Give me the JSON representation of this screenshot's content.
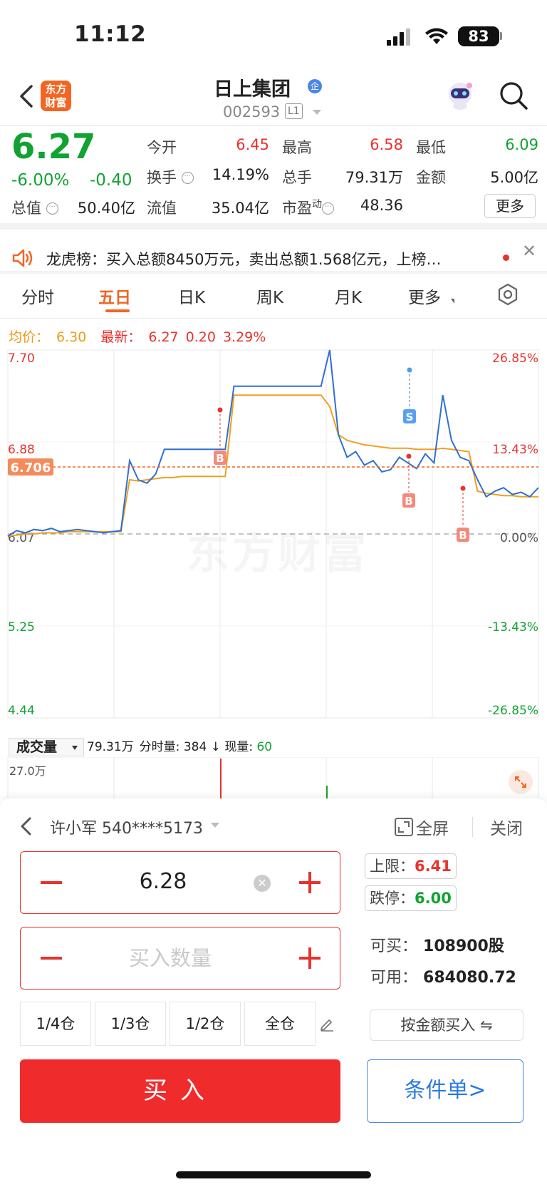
{
  "status": {
    "time": "11:12",
    "battery": "83"
  },
  "header": {
    "logo_line1": "东方",
    "logo_line2": "财富",
    "stock_name": "日上集团",
    "corp_badge": "企",
    "stock_code": "002593",
    "level_badge": "L1"
  },
  "quote": {
    "price": "6.27",
    "pct_change": "-6.00%",
    "change": "-0.40",
    "fields": {
      "open_label": "今开",
      "open_val": "6.45",
      "high_label": "最高",
      "high_val": "6.58",
      "low_label": "最低",
      "low_val": "6.09",
      "turnover_label": "换手",
      "turnover_val": "14.19%",
      "volume_label": "总手",
      "volume_val": "79.31万",
      "amount_label": "金额",
      "amount_val": "5.00亿",
      "mktcap_label": "总值",
      "mktcap_val": "50.40亿",
      "float_label": "流值",
      "float_val": "35.04亿",
      "pe_label": "市盈",
      "pe_sup": "动",
      "pe_val": "48.36"
    },
    "more_label": "更多"
  },
  "news": {
    "text": "龙虎榜：买入总额8450万元，卖出总额1.568亿元，上榜…"
  },
  "tabs": [
    "分时",
    "五日",
    "日K",
    "周K",
    "月K",
    "更多"
  ],
  "active_tab": "五日",
  "chart_info": {
    "avg_label": "均价：",
    "avg_val": "6.30",
    "latest_label": "最新：",
    "latest_val": "6.27",
    "latest_chg": "0.20",
    "latest_pct": "3.29%"
  },
  "chart_data": {
    "type": "line",
    "left_ticks": [
      "7.70",
      "6.88",
      "6.07",
      "5.25",
      "4.44"
    ],
    "right_ticks": [
      "26.85%",
      "13.43%",
      "0.00%",
      "-13.43%",
      "-26.85%"
    ],
    "ylim": [
      4.44,
      7.7
    ],
    "days": 5,
    "crosshair_label": "6.706",
    "markers": [
      "B",
      "B",
      "S",
      "B"
    ],
    "series": [
      {
        "values": [
          6.05,
          6.1,
          6.08,
          6.11,
          6.1,
          6.12,
          6.09,
          6.1,
          6.11,
          6.1,
          6.09,
          6.08,
          6.09,
          6.1,
          6.72,
          6.55,
          6.52,
          6.6,
          6.82,
          6.82,
          6.82,
          6.82,
          6.82,
          6.82,
          6.82,
          6.82,
          7.38,
          7.38,
          7.38,
          7.38,
          7.38,
          7.38,
          7.38,
          7.38,
          7.38,
          7.38,
          7.38,
          7.7,
          6.95,
          6.75,
          6.8,
          6.68,
          6.72,
          6.62,
          6.64,
          6.75,
          6.7,
          6.65,
          6.78,
          6.7,
          7.3,
          6.9,
          6.75,
          6.72,
          6.55,
          6.4,
          6.45,
          6.48,
          6.42,
          6.44,
          6.4,
          6.48
        ]
      },
      {
        "values": [
          6.05,
          6.06,
          6.07,
          6.07,
          6.08,
          6.08,
          6.08,
          6.09,
          6.09,
          6.09,
          6.09,
          6.09,
          6.09,
          6.09,
          6.55,
          6.54,
          6.55,
          6.56,
          6.57,
          6.57,
          6.58,
          6.58,
          6.58,
          6.58,
          6.58,
          6.58,
          7.3,
          7.3,
          7.3,
          7.3,
          7.3,
          7.3,
          7.3,
          7.3,
          7.3,
          7.3,
          7.3,
          7.2,
          6.95,
          6.9,
          6.88,
          6.86,
          6.85,
          6.84,
          6.83,
          6.83,
          6.83,
          6.82,
          6.82,
          6.82,
          6.83,
          6.82,
          6.81,
          6.8,
          6.45,
          6.43,
          6.42,
          6.41,
          6.41,
          6.4,
          6.4,
          6.4
        ]
      }
    ]
  },
  "volume": {
    "selector": "成交量",
    "total": "79.31万",
    "tick_label": "分时量:",
    "tick_val": "384",
    "cur_label": "现量:",
    "cur_val": "60",
    "max": "27.0万"
  },
  "trade": {
    "account": "许小军 540****5173",
    "fullscreen": "全屏",
    "close": "关闭",
    "price_value": "6.28",
    "qty_placeholder": "买入数量",
    "upper_label": "上限：",
    "upper_val": "6.41",
    "lower_label": "跌停：",
    "lower_val": "6.00",
    "can_buy_label": "可买：",
    "can_buy_val": "108900股",
    "available_label": "可用：",
    "available_val": "684080.72",
    "positions": [
      "1/4仓",
      "1/3仓",
      "1/2仓",
      "全仓"
    ],
    "by_amount": "按金额买入 ⇋",
    "buy": "买入",
    "conditional": "条件单>"
  },
  "colors": {
    "up": "#e8322c",
    "down": "#12a232",
    "brand": "#f26522",
    "price_line": "#2f6fd0",
    "avg_line": "#f0a020"
  }
}
